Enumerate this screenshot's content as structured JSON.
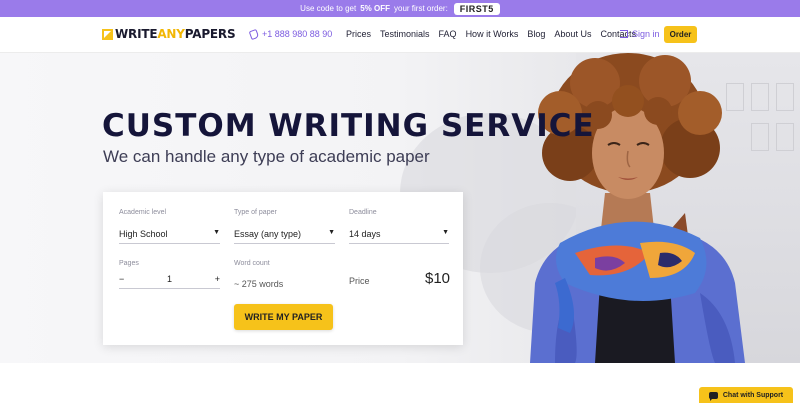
{
  "promo": {
    "text_before": "Use code to get",
    "discount": "5% OFF",
    "text_after": "your first order:",
    "code": "FIRST5"
  },
  "header": {
    "logo": {
      "part1": "WRITE",
      "part2": "ANY",
      "part3": "PAPERS"
    },
    "phone": "+1 888 980 88 90",
    "nav": [
      "Prices",
      "Testimonials",
      "FAQ",
      "How it Works",
      "Blog",
      "About Us",
      "Contacts"
    ],
    "sign_in": "Sign in",
    "order_button": "Order"
  },
  "hero": {
    "title": "CUSTOM WRITING SERVICE",
    "subtitle": "We can handle any type of academic paper"
  },
  "form": {
    "academic_level": {
      "label": "Academic level",
      "value": "High School"
    },
    "paper_type": {
      "label": "Type of paper",
      "value": "Essay (any type)"
    },
    "deadline": {
      "label": "Deadline",
      "value": "14 days"
    },
    "pages": {
      "label": "Pages",
      "value": "1",
      "minus": "−",
      "plus": "+"
    },
    "word_count": {
      "label": "Word count",
      "value": "~ 275 words"
    },
    "price": {
      "label": "Price",
      "value": "$10"
    },
    "submit": "WRITE MY PAPER"
  },
  "chat": {
    "label": "Chat with Support"
  },
  "colors": {
    "accent": "#f6c21a",
    "purple": "#7c5ce0",
    "promo_bg": "#9a7bea",
    "title": "#15153a"
  },
  "icons": {
    "phone": "phone-icon",
    "sign_in": "sign-in-icon",
    "caret": "caret-down-icon",
    "chat": "chat-bubble-icon",
    "logo": "logo-mark-icon"
  }
}
